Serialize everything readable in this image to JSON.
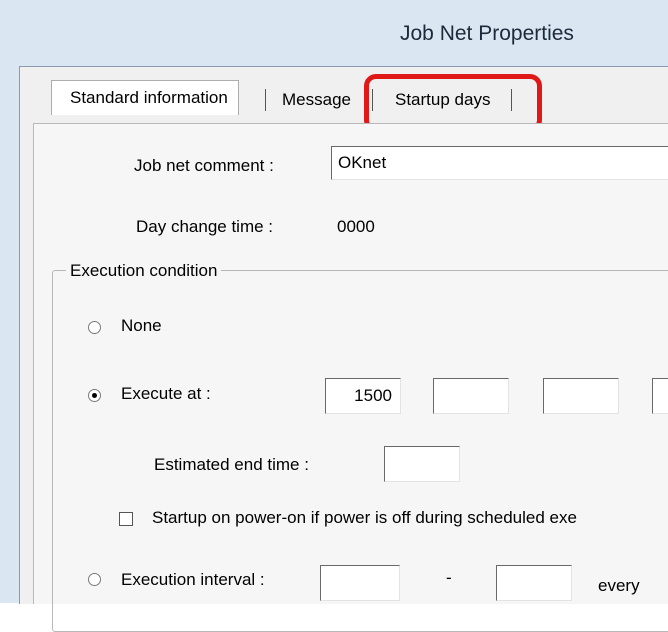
{
  "window": {
    "title": "Job Net Properties"
  },
  "tabs": [
    {
      "label": "Standard information"
    },
    {
      "label": "Message"
    },
    {
      "label": "Startup days"
    }
  ],
  "form": {
    "job_net_comment_label": "Job net comment :",
    "job_net_comment_value": "OKnet",
    "day_change_time_label": "Day change time :",
    "day_change_time_value": "0000",
    "execution_condition_title": "Execution condition",
    "none_label": "None",
    "execute_at_label": "Execute at :",
    "execute_at_values": [
      "1500",
      "",
      "",
      ""
    ],
    "estimated_end_time_label": "Estimated end time :",
    "estimated_end_time_value": "",
    "startup_power_label": "Startup on power-on if power is off during scheduled exe",
    "execution_interval_label": "Execution interval :",
    "execution_interval_from": "",
    "execution_interval_dash": "-",
    "execution_interval_to": "",
    "every_label": "every"
  },
  "state": {
    "selected_condition": "execute_at",
    "startup_power_checked": false
  },
  "colors": {
    "highlight": "#e01818",
    "titlebar": "#dbe6f3"
  }
}
